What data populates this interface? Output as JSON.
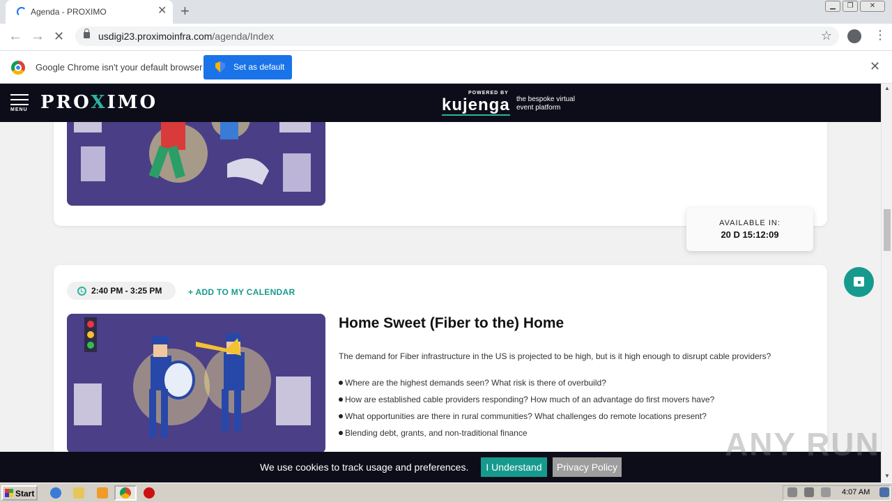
{
  "browser": {
    "tab_title": "Agenda - PROXIMO",
    "tab_close": "✕",
    "new_tab": "+",
    "url_host": "usdigi23.proximoinfra.com",
    "url_path": "/agenda/Index",
    "back": "←",
    "forward": "→",
    "reload": "✕",
    "star": "☆",
    "kebab": "⋮"
  },
  "infobar": {
    "message": "Google Chrome isn't your default browser",
    "button": "Set as default",
    "close": "✕"
  },
  "site_header": {
    "menu_label": "MENU",
    "brand_pre": "PRO",
    "brand_x": "X",
    "brand_post": "IMO",
    "powered_by": "POWERED BY",
    "sponsor": "kujenga",
    "sponsor_tag_1": "the bespoke virtual",
    "sponsor_tag_2": "event platform"
  },
  "availability": {
    "label": "AVAILABLE IN:",
    "value": "20 D 15:12:09"
  },
  "session": {
    "time": "2:40 PM - 3:25 PM",
    "add_calendar": "+ ADD TO MY CALENDAR",
    "title": "Home Sweet (Fiber to the) Home",
    "description": "The demand for Fiber infrastructure in the US is projected to be high, but is it high enough to disrupt cable providers?",
    "bullets": [
      "Where are the highest demands seen? What risk is there of overbuild?",
      "How are established cable providers responding? How much of an advantage do first movers have?",
      "What opportunities are there in rural communities? What challenges do remote locations present?",
      "Blending debt, grants, and non-traditional finance"
    ]
  },
  "cookie_bar": {
    "message": "We use cookies to track usage and preferences.",
    "accept": "I Understand",
    "policy": "Privacy Policy"
  },
  "watermark": "ANY RUN",
  "taskbar": {
    "start": "Start",
    "clock": "4:07 AM"
  },
  "colors": {
    "accent": "#179a8e",
    "header_bg": "#0d0d1a",
    "chrome_blue": "#1a73e8"
  }
}
